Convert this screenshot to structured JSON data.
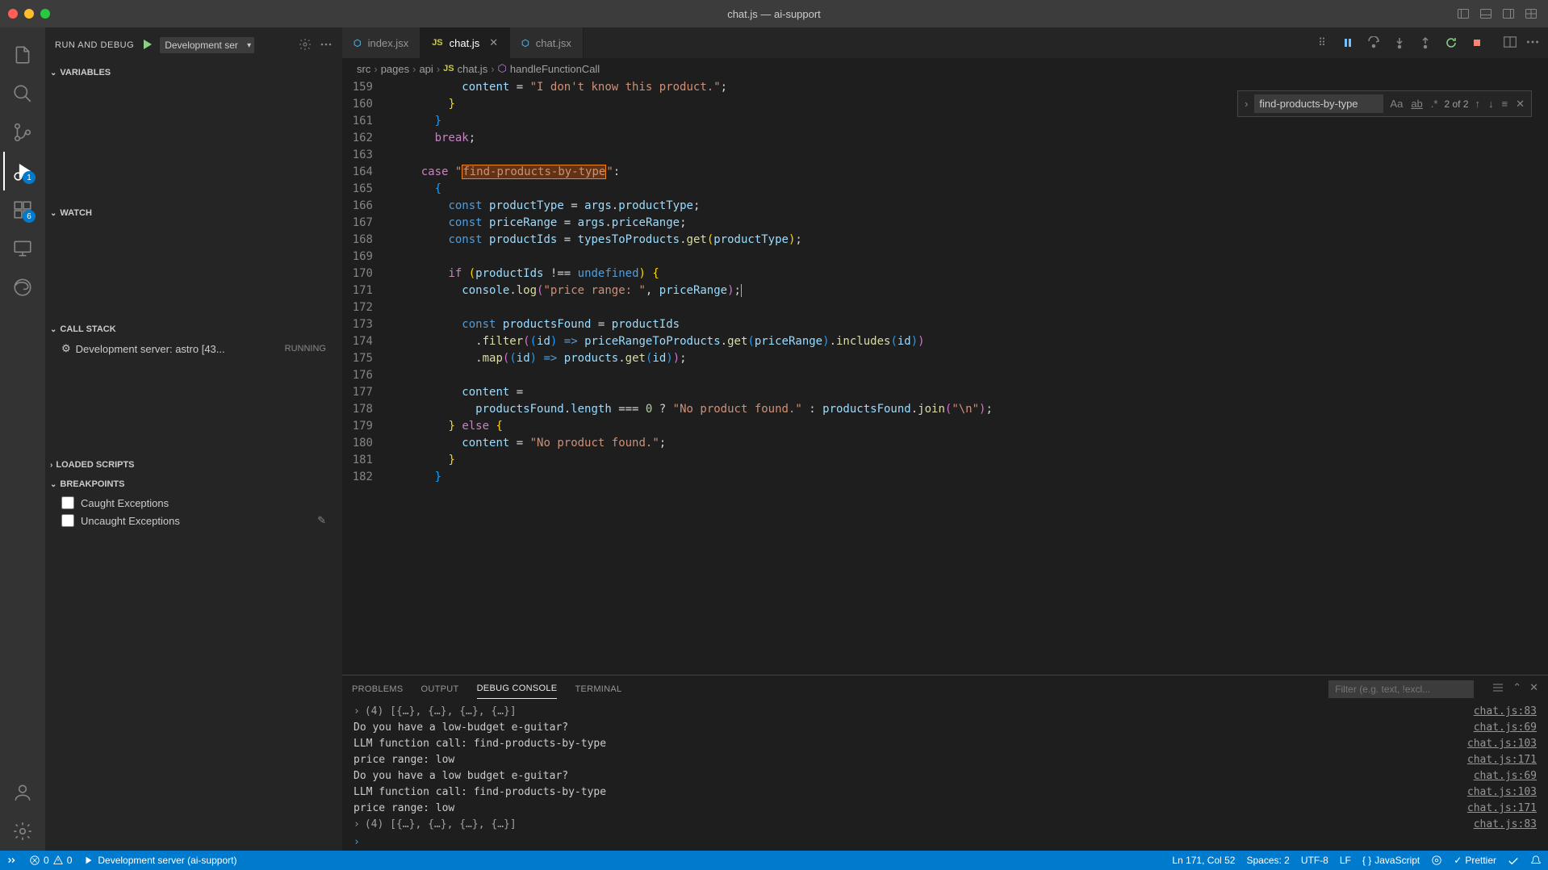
{
  "titlebar": {
    "title": "chat.js — ai-support"
  },
  "activityBar": {
    "debugBadge": "1",
    "extensionsBadge": "6"
  },
  "sidebar": {
    "runDebugLabel": "RUN AND DEBUG",
    "configName": "Development ser",
    "sections": {
      "variables": "VARIABLES",
      "watch": "WATCH",
      "callStack": "CALL STACK",
      "loadedScripts": "LOADED SCRIPTS",
      "breakpoints": "BREAKPOINTS"
    },
    "callStackItem": {
      "label": "Development server: astro [43...",
      "status": "RUNNING"
    },
    "breakpointItems": [
      "Caught Exceptions",
      "Uncaught Exceptions"
    ]
  },
  "tabs": [
    {
      "icon": "react",
      "label": "index.jsx",
      "active": false
    },
    {
      "icon": "js",
      "label": "chat.js",
      "active": true,
      "closable": true
    },
    {
      "icon": "react",
      "label": "chat.jsx",
      "active": false
    }
  ],
  "breadcrumb": {
    "parts": [
      "src",
      "pages",
      "api",
      "chat.js",
      "handleFunctionCall"
    ]
  },
  "find": {
    "value": "find-products-by-type",
    "count": "2 of 2"
  },
  "lineNumbers": [
    "159",
    "160",
    "161",
    "162",
    "163",
    "164",
    "165",
    "166",
    "167",
    "168",
    "169",
    "170",
    "171",
    "172",
    "173",
    "174",
    "175",
    "176",
    "177",
    "178",
    "179",
    "180",
    "181",
    "182"
  ],
  "panel": {
    "tabs": [
      "PROBLEMS",
      "OUTPUT",
      "DEBUG CONSOLE",
      "TERMINAL"
    ],
    "activeTab": "DEBUG CONSOLE",
    "filterPlaceholder": "Filter (e.g. text, !excl...",
    "lines": [
      {
        "pre": ">",
        "text": "(4) [{…}, {…}, {…}, {…}]",
        "src": "chat.js:83",
        "gray": true
      },
      {
        "text": "Do you have a low-budget e-guitar?",
        "src": "chat.js:69"
      },
      {
        "text": "LLM function call:  find-products-by-type",
        "src": "chat.js:103"
      },
      {
        "text": "price range:  low",
        "src": "chat.js:171"
      },
      {
        "text": "Do you have a low budget e-guitar?",
        "src": "chat.js:69"
      },
      {
        "text": "LLM function call:  find-products-by-type",
        "src": "chat.js:103"
      },
      {
        "text": "price range:  low",
        "src": "chat.js:171"
      },
      {
        "pre": ">",
        "text": "(4) [{…}, {…}, {…}, {…}]",
        "src": "chat.js:83",
        "gray": true
      }
    ]
  },
  "statusbar": {
    "errors": "0",
    "warnings": "0",
    "debugTarget": "Development server (ai-support)",
    "cursor": "Ln 171, Col 52",
    "spaces": "Spaces: 2",
    "encoding": "UTF-8",
    "eol": "LF",
    "language": "JavaScript",
    "prettier": "Prettier"
  },
  "chart_data": null
}
